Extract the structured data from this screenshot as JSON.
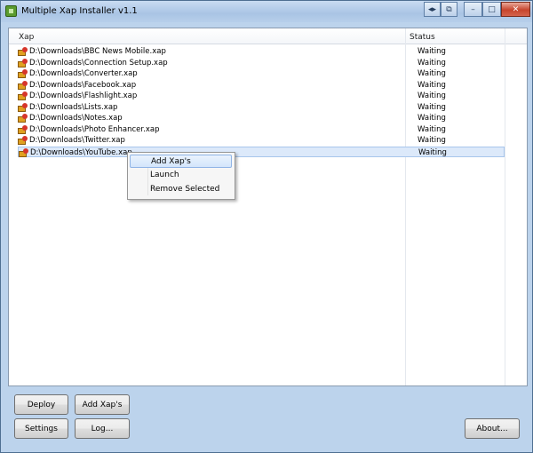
{
  "window": {
    "title": "Multiple Xap Installer v1.1"
  },
  "list": {
    "columns": [
      "Xap",
      "Status"
    ],
    "rows": [
      {
        "path": "D:\\Downloads\\BBC News Mobile.xap",
        "status": "Waiting"
      },
      {
        "path": "D:\\Downloads\\Connection Setup.xap",
        "status": "Waiting"
      },
      {
        "path": "D:\\Downloads\\Converter.xap",
        "status": "Waiting"
      },
      {
        "path": "D:\\Downloads\\Facebook.xap",
        "status": "Waiting"
      },
      {
        "path": "D:\\Downloads\\Flashlight.xap",
        "status": "Waiting"
      },
      {
        "path": "D:\\Downloads\\Lists.xap",
        "status": "Waiting"
      },
      {
        "path": "D:\\Downloads\\Notes.xap",
        "status": "Waiting"
      },
      {
        "path": "D:\\Downloads\\Photo Enhancer.xap",
        "status": "Waiting"
      },
      {
        "path": "D:\\Downloads\\Twitter.xap",
        "status": "Waiting"
      },
      {
        "path": "D:\\Downloads\\YouTube.xap",
        "status": "Waiting"
      }
    ]
  },
  "context_menu": {
    "items": [
      "Add Xap's",
      "Launch",
      "Remove Selected"
    ]
  },
  "buttons": {
    "deploy": "Deploy",
    "add": "Add Xap's",
    "settings": "Settings",
    "log": "Log...",
    "about": "About..."
  },
  "titlebar_buttons": {
    "extra1": "◂▸",
    "extra2": "⧉",
    "minimize": "–",
    "maximize": "□",
    "close": "✕"
  }
}
